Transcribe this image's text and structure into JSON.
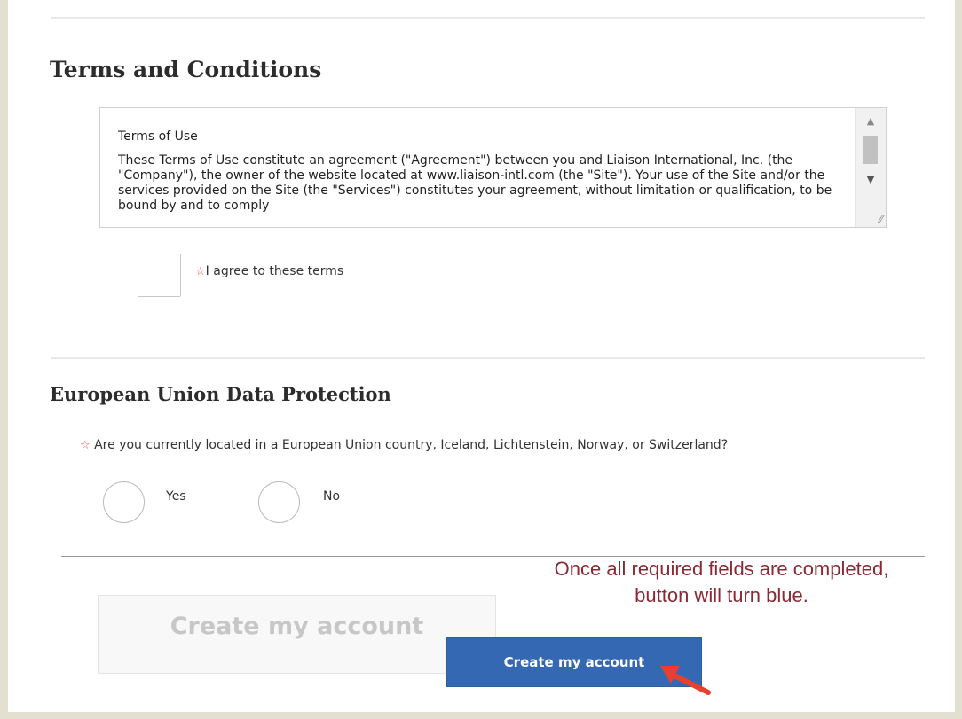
{
  "terms": {
    "heading": "Terms and Conditions",
    "box_title": "Terms of Use",
    "box_body": "These Terms of Use constitute an agreement (\"Agreement\") between you and Liaison International, Inc. (the \"Company\"), the owner of the website located at www.liaison-intl.com (the \"Site\"). Your use of the Site and/or the services provided on the Site (the \"Services\") constitutes your agreement, without limitation or qualification, to be bound by and to comply",
    "agree_label": "I agree to these terms",
    "required_marker": "☆"
  },
  "eu": {
    "heading": "European Union Data Protection",
    "question": "Are you currently located in a European Union country, Iceland, Lichtenstein, Norway, or Switzerland?",
    "required_marker": "☆",
    "options": [
      {
        "label": "Yes"
      },
      {
        "label": "No"
      }
    ]
  },
  "submit": {
    "disabled_label": "Create my account",
    "active_label": "Create my account"
  },
  "annotation": {
    "callout_text": "Once all required fields are completed, button will turn blue."
  },
  "icons": {
    "scroll_up": "scroll-up-arrow-icon",
    "scroll_down": "scroll-down-arrow-icon",
    "resize": "resize-grip-icon",
    "pointer": "red-arrow-icon"
  },
  "colors": {
    "primary_button": "#3568b3",
    "callout_text": "#8b2a34",
    "required_star": "#d9534f",
    "arrow": "#e8402e"
  }
}
